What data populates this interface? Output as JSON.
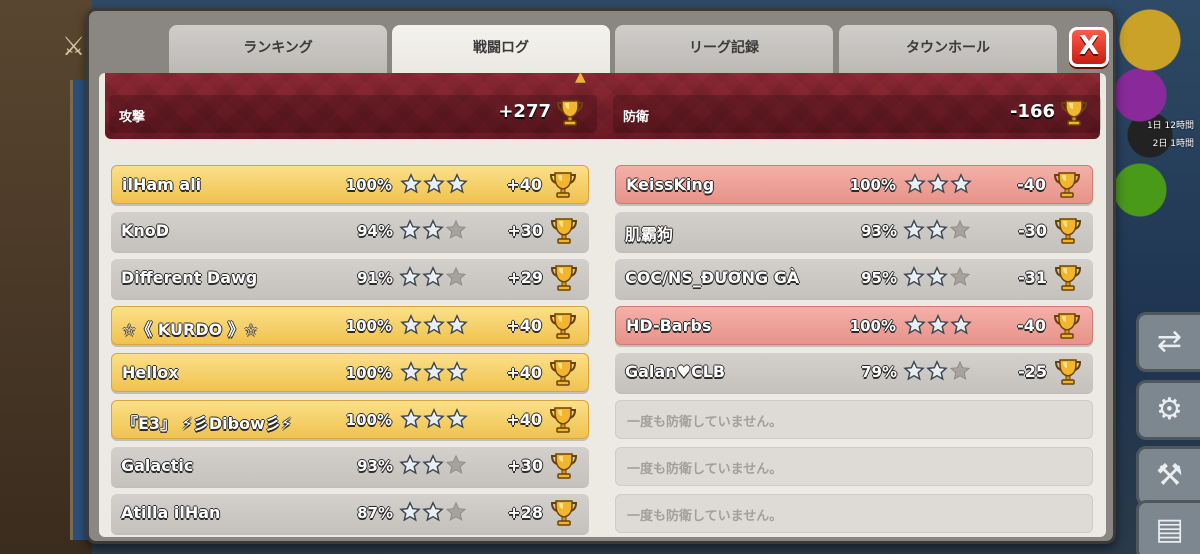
{
  "tabs": [
    {
      "label": "ランキング"
    },
    {
      "label": "戦闘ログ"
    },
    {
      "label": "リーグ記録"
    },
    {
      "label": "タウンホール"
    }
  ],
  "close_label": "X",
  "summary": {
    "attack": {
      "label": "攻撃",
      "value": "+277"
    },
    "defense": {
      "label": "防衛",
      "value": "-166"
    }
  },
  "attacks": [
    {
      "name": "ilHam ali",
      "percent": "100%",
      "stars": 3,
      "trophies": "+40",
      "style": "gold"
    },
    {
      "name": "KnoD",
      "percent": "94%",
      "stars": 2,
      "trophies": "+30",
      "style": "gray"
    },
    {
      "name": "Different Dawg",
      "percent": "91%",
      "stars": 2,
      "trophies": "+29",
      "style": "gray"
    },
    {
      "name": "☆《 KURDO 》☆",
      "percent": "100%",
      "stars": 3,
      "trophies": "+40",
      "style": "gold"
    },
    {
      "name": "Hellox",
      "percent": "100%",
      "stars": 3,
      "trophies": "+40",
      "style": "gold"
    },
    {
      "name": "『E3』 ⚡彡Dibow彡⚡",
      "percent": "100%",
      "stars": 3,
      "trophies": "+40",
      "style": "gold"
    },
    {
      "name": "Galactic",
      "percent": "93%",
      "stars": 2,
      "trophies": "+30",
      "style": "gray"
    },
    {
      "name": "Atilla ilHan",
      "percent": "87%",
      "stars": 2,
      "trophies": "+28",
      "style": "gray"
    }
  ],
  "defenses": [
    {
      "name": "KeissKing",
      "percent": "100%",
      "stars": 3,
      "trophies": "-40",
      "style": "red"
    },
    {
      "name": "肌霸狗",
      "percent": "93%",
      "stars": 2,
      "trophies": "-30",
      "style": "gray"
    },
    {
      "name": "COC/NS_ĐƯƠNG GÀ",
      "percent": "95%",
      "stars": 2,
      "trophies": "-31",
      "style": "gray"
    },
    {
      "name": "HD-Barbs",
      "percent": "100%",
      "stars": 3,
      "trophies": "-40",
      "style": "red"
    },
    {
      "name": "Galan♥CLB",
      "percent": "79%",
      "stars": 2,
      "trophies": "-25",
      "style": "gray"
    },
    {
      "empty_text": "一度も防衛していません。",
      "style": "empty"
    },
    {
      "empty_text": "一度も防衛していません。",
      "style": "empty"
    },
    {
      "empty_text": "一度も防衛していません。",
      "style": "empty"
    }
  ],
  "side_labels": [
    "1日 12時間",
    "2日 1時間"
  ],
  "colors": {
    "gold_row": "#f0c24f",
    "red_row": "#e79389",
    "gray_row": "#c5c2bd",
    "banner": "#7a1f2b",
    "close": "#e0271a",
    "trophy": "#e2a72b"
  },
  "icons": {
    "trophy": "trophy-icon",
    "star": "star-icon",
    "close": "close-icon",
    "sword": "sword-icon"
  }
}
